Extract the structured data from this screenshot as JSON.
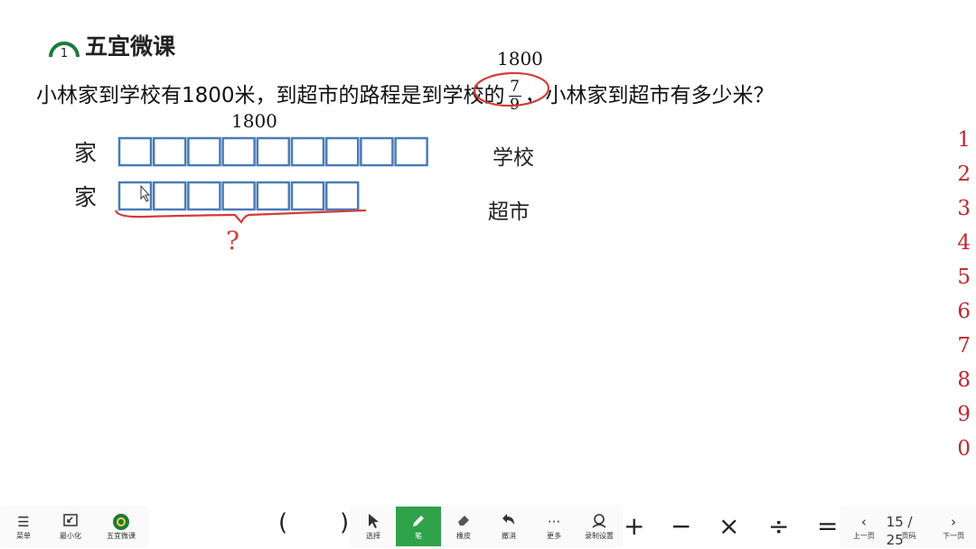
{
  "header": {
    "brand": "五宜微课",
    "logo_glyph": "1"
  },
  "problem": {
    "text_part1": "小林家到学校有1800米，到超市的路程是",
    "highlighted": "到学校",
    "text_part2": "的",
    "fraction": {
      "numerator": "7",
      "denominator": "9"
    },
    "text_part3": "，小林家到超市有多少米？",
    "annotation_above": "1800"
  },
  "diagram": {
    "segment_label": "1800",
    "row1": {
      "start": "家",
      "end": "学校",
      "boxes": 9
    },
    "row2": {
      "start": "家",
      "end": "超市",
      "boxes": 7
    },
    "question_mark": "?"
  },
  "side_numbers": [
    "1",
    "2",
    "3",
    "4",
    "5",
    "6",
    "7",
    "8",
    "9",
    "0"
  ],
  "toolbar": {
    "left": [
      {
        "label": "菜单",
        "icon": "menu-icon"
      },
      {
        "label": "最小化",
        "icon": "minimize-icon"
      },
      {
        "label": "五宜微课",
        "icon": "app-logo-icon"
      }
    ],
    "paren_open": "(",
    "paren_close": ")",
    "tools": [
      {
        "label": "选择",
        "icon": "cursor-icon"
      },
      {
        "label": "笔",
        "icon": "pen-icon",
        "active": true
      },
      {
        "label": "橡皮",
        "icon": "eraser-icon"
      },
      {
        "label": "撤消",
        "icon": "undo-icon"
      },
      {
        "label": "更多",
        "icon": "more-icon"
      },
      {
        "label": "录制设置",
        "icon": "record-settings-icon"
      }
    ],
    "operators": [
      "+",
      "−",
      "×",
      "÷",
      "="
    ],
    "nav": {
      "prev": "上一页",
      "page": "页码",
      "page_indicator": "15 / 25",
      "next": "下一页"
    }
  },
  "colors": {
    "accent": "#2fa24a",
    "red_annotation": "#d63a3a",
    "box_border": "#4a7bb7"
  }
}
